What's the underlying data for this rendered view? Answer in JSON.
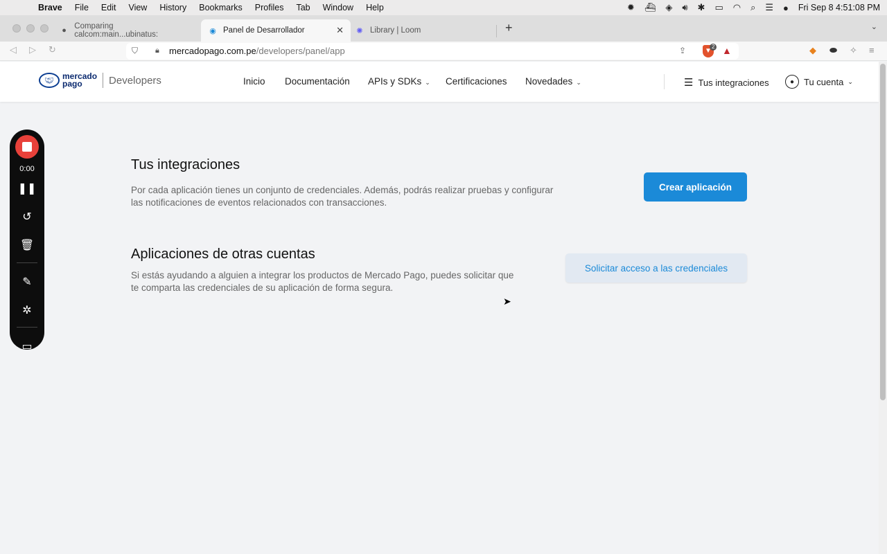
{
  "menubar": {
    "apple_icon": "apple-icon",
    "items": [
      "Brave",
      "File",
      "Edit",
      "View",
      "History",
      "Bookmarks",
      "Profiles",
      "Tab",
      "Window",
      "Help"
    ],
    "datetime": "Fri Sep 8  4:51:08 PM"
  },
  "tabs": [
    {
      "label": "Comparing calcom:main...ubinatus:",
      "icon": "github-icon",
      "active": false
    },
    {
      "label": "Panel de Desarrollador",
      "icon": "mercadopago-icon",
      "active": true
    },
    {
      "label": "Library | Loom",
      "icon": "loom-icon",
      "active": false
    }
  ],
  "address": {
    "domain": "mercadopago.com.pe",
    "path": "/developers/panel/app",
    "shields_count": "2"
  },
  "site": {
    "logo_text_line1": "mercado",
    "logo_text_line2": "pago",
    "logo_suffix": "Developers",
    "nav": [
      "Inicio",
      "Documentación",
      "APIs y SDKs",
      "Certificaciones",
      "Novedades"
    ],
    "integrations_link": "Tus integraciones",
    "account_link": "Tu cuenta"
  },
  "main": {
    "section1": {
      "title": "Tus integraciones",
      "line1": "Por cada aplicación tienes un conjunto de credenciales. Además, podrás realizar pruebas y configurar",
      "line2": "las notificaciones de eventos relacionados con transacciones.",
      "button": "Crear aplicación"
    },
    "section2": {
      "title": "Aplicaciones de otras cuentas",
      "line1": "Si estás ayudando a alguien a integrar los productos de Mercado Pago, puedes solicitar que",
      "line2": "te comparta las credenciales de su aplicación de forma segura.",
      "button": "Solicitar acceso a las credenciales"
    }
  },
  "loom": {
    "timer": "0:00"
  },
  "colors": {
    "primary_button": "#1b8ad8",
    "secondary_button_bg": "#e2e9f2",
    "record_red": "#e8413a",
    "page_bg": "#f2f3f5"
  }
}
